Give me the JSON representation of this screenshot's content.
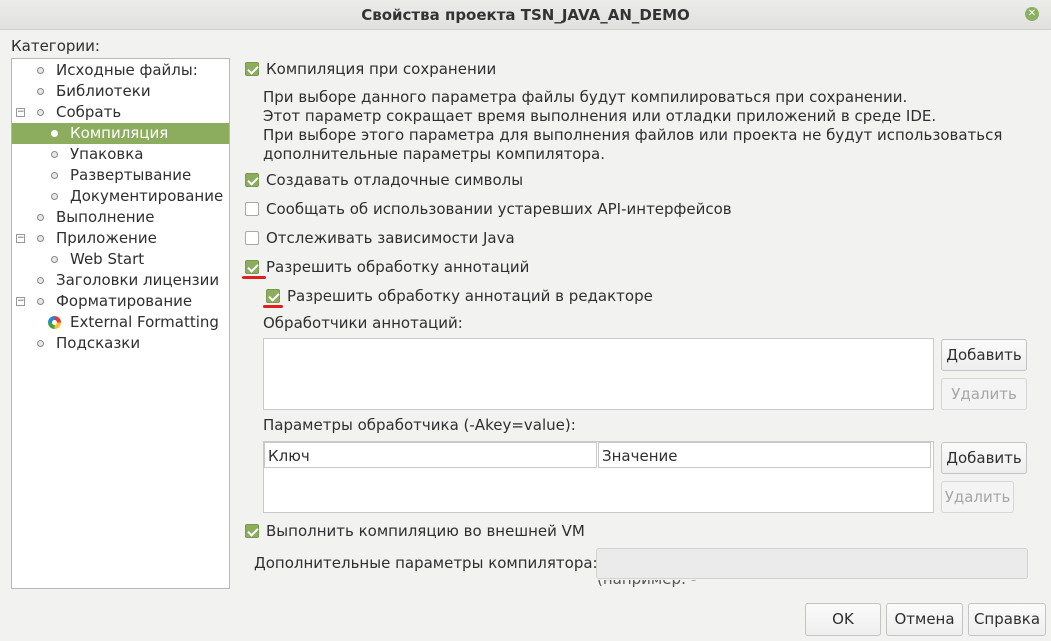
{
  "window": {
    "title": "Свойства проекта TSN_JAVA_AN_DEMO",
    "close_icon": "close-icon"
  },
  "categories": {
    "label": "Категории:",
    "items": [
      {
        "label": "Исходные файлы:"
      },
      {
        "label": "Библиотеки"
      },
      {
        "label": "Собрать"
      },
      {
        "label": "Компиляция"
      },
      {
        "label": "Упаковка"
      },
      {
        "label": "Развертывание"
      },
      {
        "label": "Документирование"
      },
      {
        "label": "Выполнение"
      },
      {
        "label": "Приложение"
      },
      {
        "label": "Web Start"
      },
      {
        "label": "Заголовки лицензии"
      },
      {
        "label": "Форматирование"
      },
      {
        "label": "External Formatting"
      },
      {
        "label": "Подсказки"
      }
    ]
  },
  "compile": {
    "on_save": {
      "label": "Компиляция при сохранении",
      "checked": true
    },
    "description": [
      "При выборе данного параметра файлы будут компилироваться при сохранении.",
      "Этот параметр сокращает время выполнения или отладки приложений в среде IDE.",
      "При выборе этого параметра для выполнения файлов или проекта не будут использоваться",
      "дополнительные параметры компилятора."
    ],
    "debug_symbols": {
      "label": "Создавать отладочные символы",
      "checked": true
    },
    "deprecated_api": {
      "label": "Сообщать об использовании устаревших API-интерфейсов",
      "checked": false
    },
    "track_deps": {
      "label": "Отслеживать зависимости Java",
      "checked": false
    },
    "annotation_processing": {
      "label": "Разрешить обработку аннотаций",
      "checked": true
    },
    "annotation_in_editor": {
      "label": "Разрешить обработку аннотаций в редакторе",
      "checked": true
    },
    "processors_label": "Обработчики аннотаций:",
    "add_label": "Добавить",
    "remove_label": "Удалить",
    "params_label": "Параметры обработчика (-Akey=value):",
    "params_columns": [
      "Ключ",
      "Значение"
    ],
    "external_vm": {
      "label": "Выполнить компиляцию во внешней VM",
      "checked": true
    },
    "extra_options_label": "Дополнительные параметры компилятора:",
    "extra_options_value": "",
    "clipped_hint": "(например: -Xlint:unchecked)"
  },
  "footer": {
    "ok": "OK",
    "cancel": "Отмена",
    "help": "Справка"
  },
  "colors": {
    "accent": "#8cac5e",
    "annotation_mark": "#e02020"
  }
}
